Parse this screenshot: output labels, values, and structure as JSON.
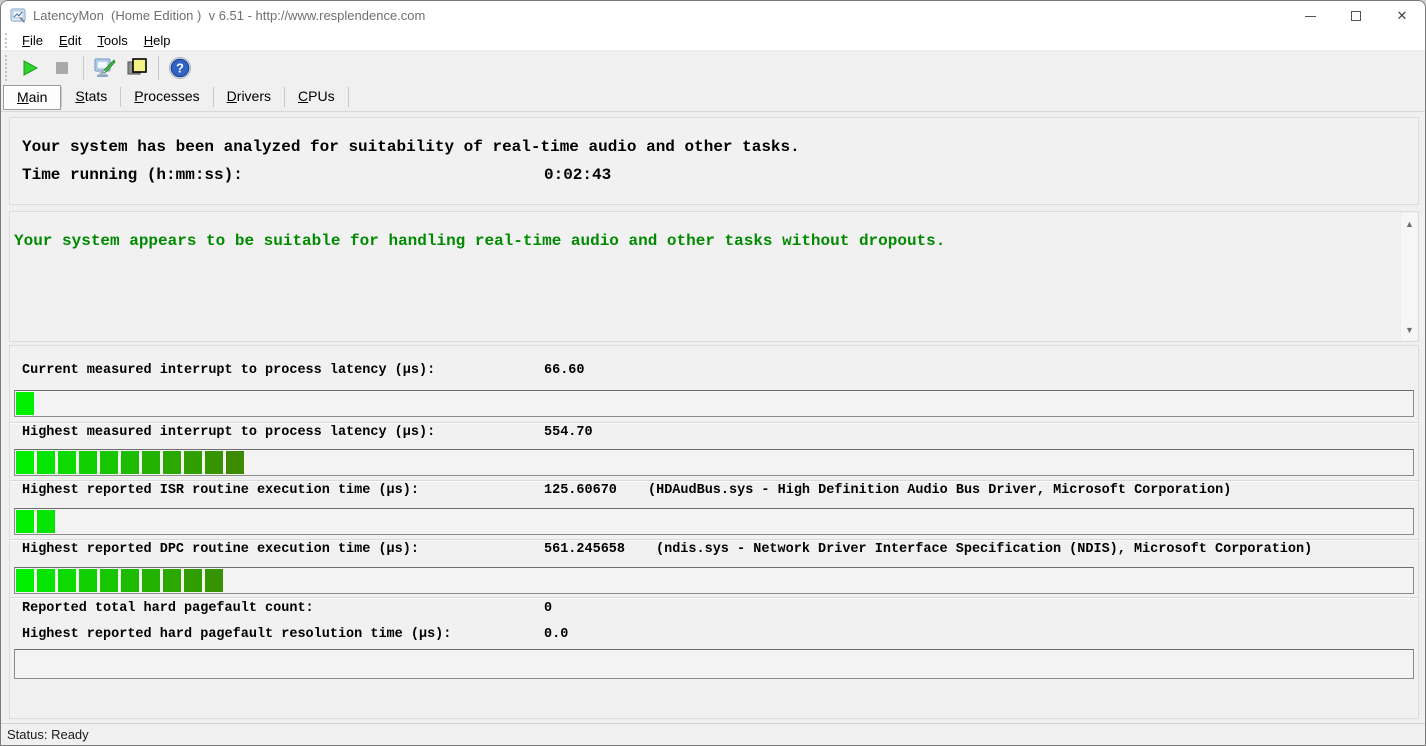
{
  "window": {
    "title": "LatencyMon  (Home Edition )  v 6.51 - http://www.resplendence.com",
    "controls": {
      "close_glyph": "✕"
    }
  },
  "menu": {
    "items": [
      "File",
      "Edit",
      "Tools",
      "Help"
    ]
  },
  "toolbar": {
    "buttons": [
      "start",
      "stop",
      "analyze",
      "report",
      "help"
    ],
    "help_glyph": "?"
  },
  "tabs": {
    "active": "Main",
    "items": [
      "Main",
      "Stats",
      "Processes",
      "Drivers",
      "CPUs"
    ]
  },
  "analysis": {
    "headline": "Your system has been analyzed for suitability of real-time audio and other tasks.",
    "time_label": "Time running (h:mm:ss):",
    "time_value": "0:02:43"
  },
  "verdict": {
    "text": "Your system appears to be suitable for handling real-time audio and other tasks without dropouts.",
    "color": "#008a00"
  },
  "metrics": {
    "rows": [
      {
        "label": "Current measured interrupt to process latency (µs):",
        "value": "66.60",
        "extra": "",
        "segments": 1
      },
      {
        "label": "Highest measured interrupt to process latency (µs):",
        "value": "554.70",
        "extra": "",
        "segments": 11
      },
      {
        "label": "Highest reported ISR routine execution time (µs):",
        "value": "125.60670",
        "extra": "(HDAudBus.sys - High Definition Audio Bus Driver, Microsoft Corporation)",
        "segments": 2
      },
      {
        "label": "Highest reported DPC routine execution time (µs):",
        "value": "561.245658",
        "extra": "(ndis.sys - Network Driver Interface Specification (NDIS), Microsoft Corporation)",
        "segments": 10
      },
      {
        "label": "Reported total hard pagefault count:",
        "value": "0",
        "extra": "",
        "segments": null
      },
      {
        "label": "Highest reported hard pagefault resolution time (µs):",
        "value": "0.0",
        "extra": "",
        "segments": 0
      }
    ],
    "bar_color_start": "#00ee00",
    "bar_color_end": "#3c8a00"
  },
  "status": {
    "text": "Status: Ready"
  }
}
